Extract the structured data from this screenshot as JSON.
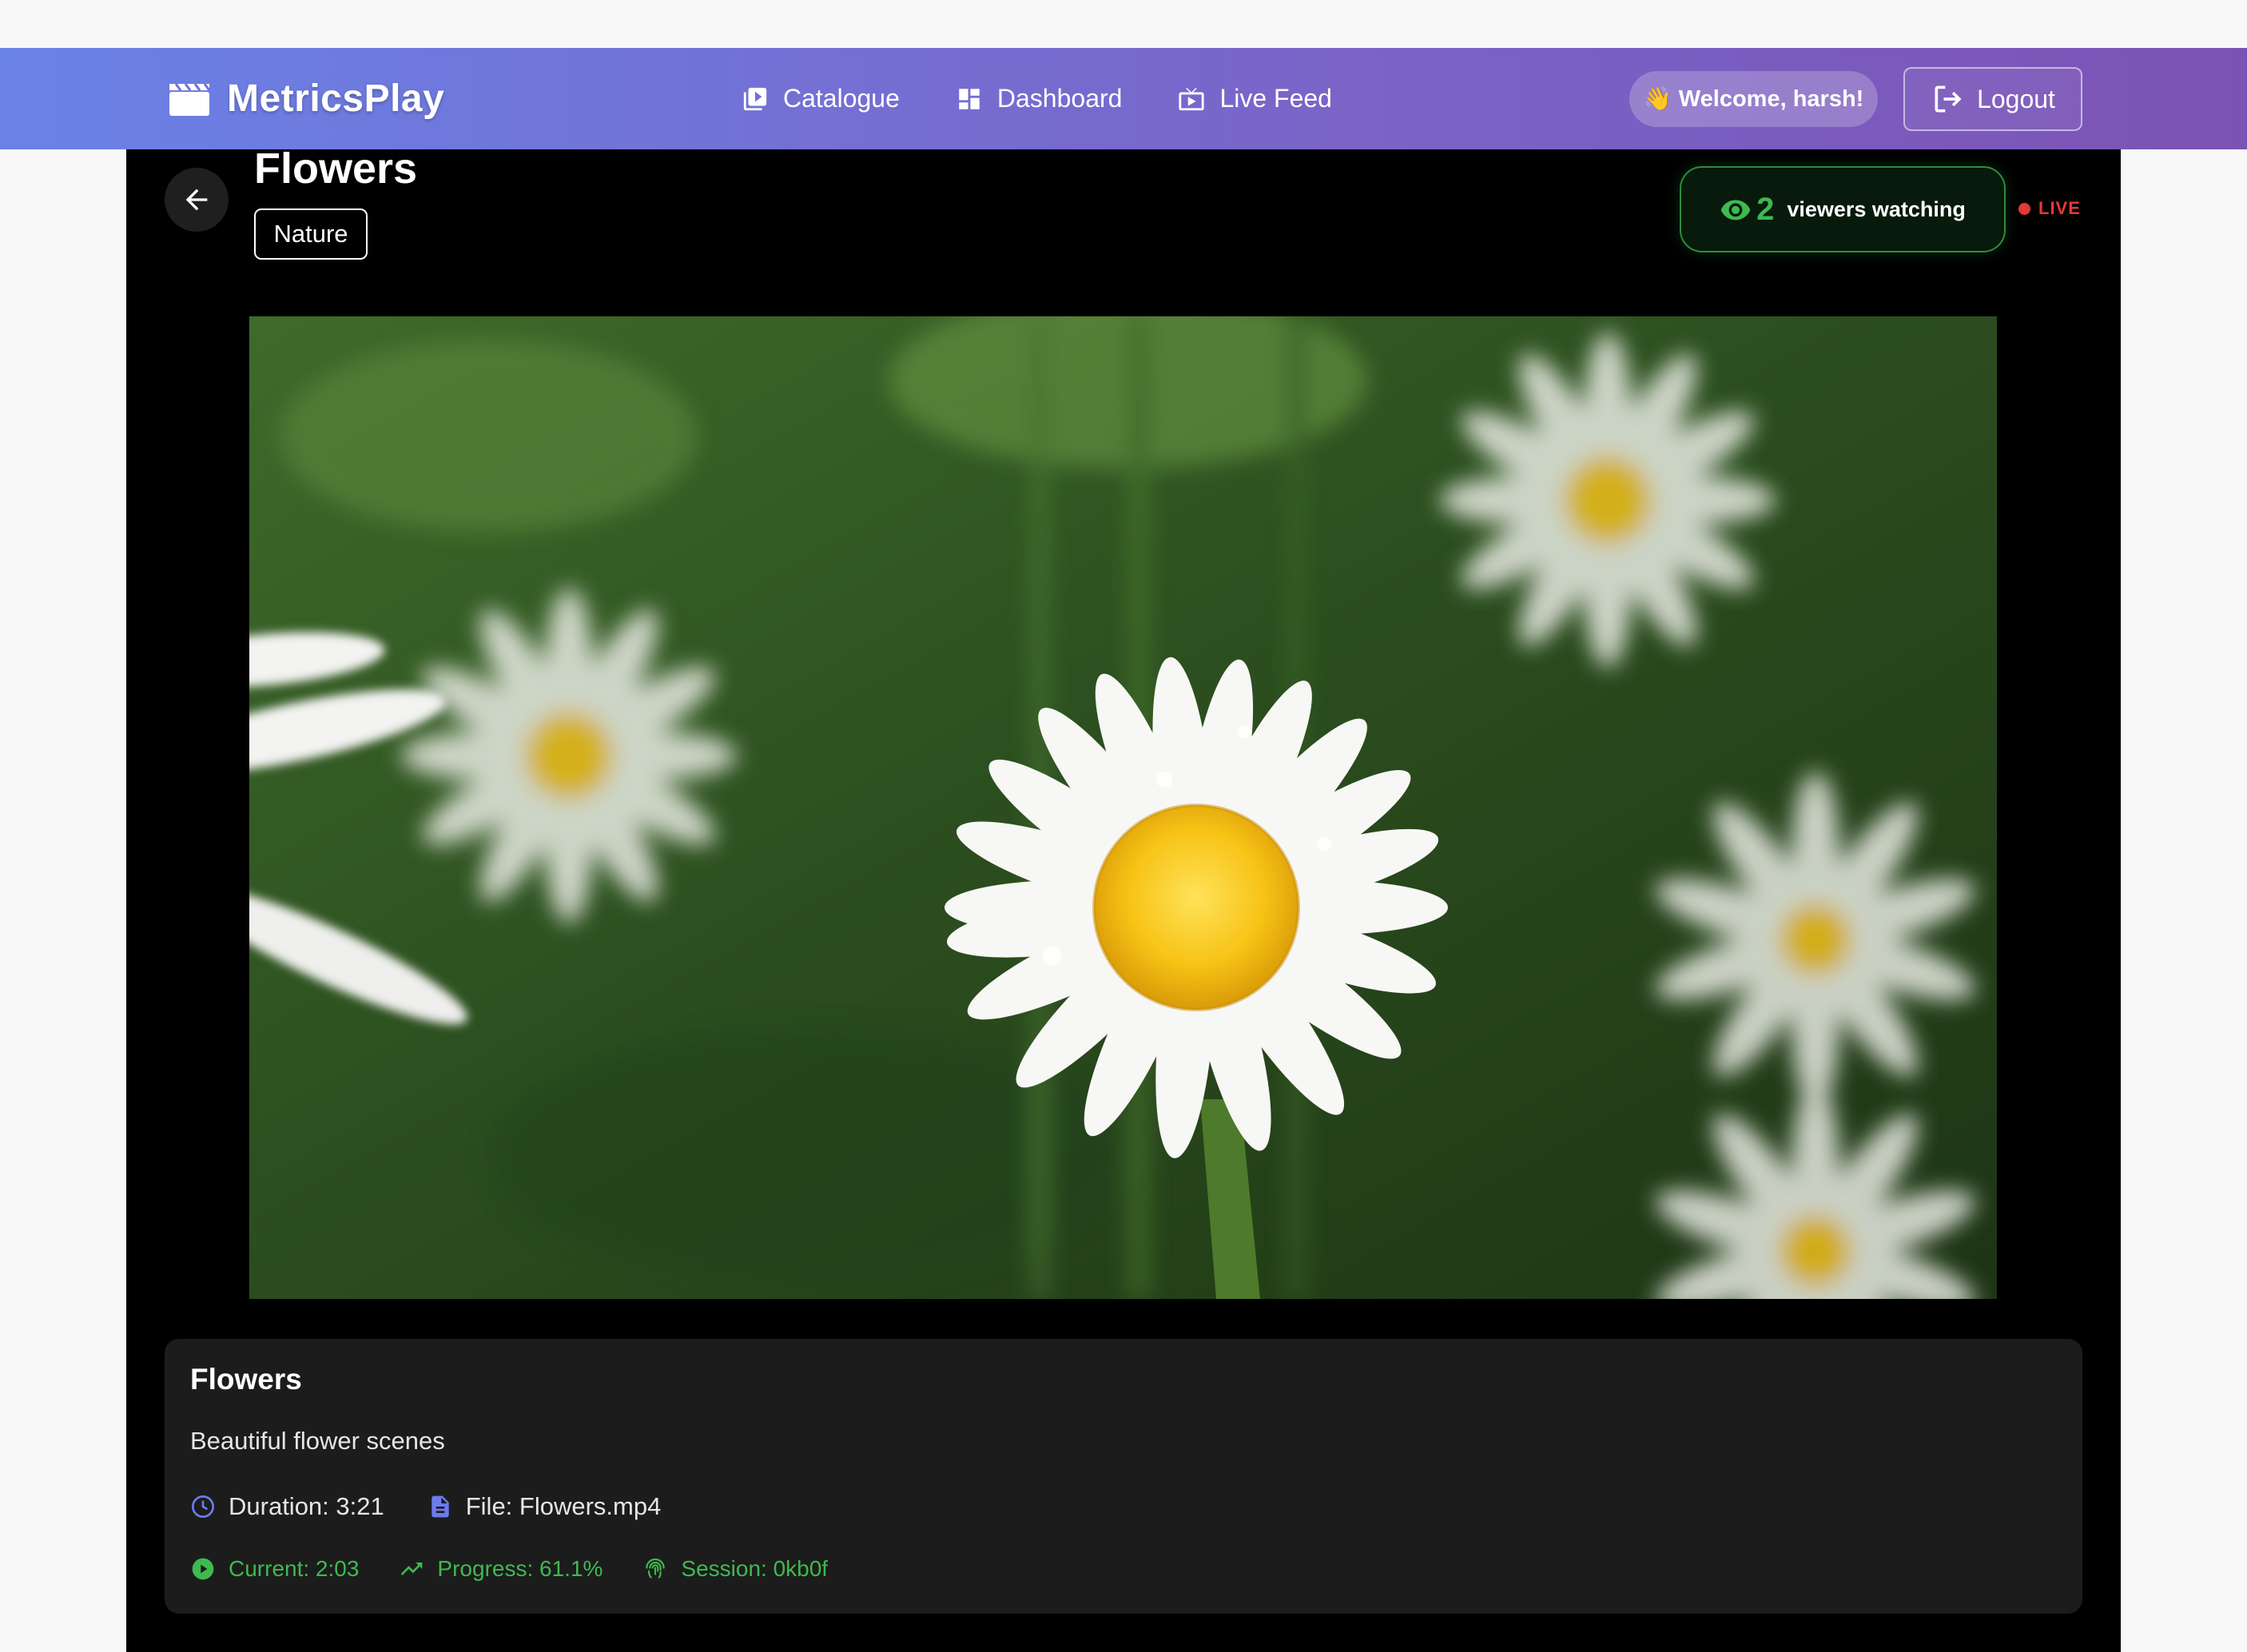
{
  "nav": {
    "brand": "MetricsPlay",
    "links": [
      {
        "label": "Catalogue",
        "icon": "video-library-icon"
      },
      {
        "label": "Dashboard",
        "icon": "dashboard-icon"
      },
      {
        "label": "Live Feed",
        "icon": "live-tv-icon"
      }
    ],
    "welcome": "👋 Welcome, harsh!",
    "logout": "Logout",
    "gradient": [
      "#6a82e6",
      "#7b53b4"
    ]
  },
  "video": {
    "title": "Flowers",
    "tag": "Nature",
    "viewers_count": "2",
    "viewers_label": "viewers watching",
    "live_label": "LIVE"
  },
  "info": {
    "title": "Flowers",
    "description": "Beautiful flower scenes",
    "duration": "Duration: 3:21",
    "file": "File: Flowers.mp4",
    "current": "Current: 2:03",
    "progress": "Progress: 61.1%",
    "session": "Session: 0kb0f"
  },
  "colors": {
    "accent_green": "#3fb950",
    "live_red": "#e53935",
    "meta_blue": "#6b7cf0"
  }
}
